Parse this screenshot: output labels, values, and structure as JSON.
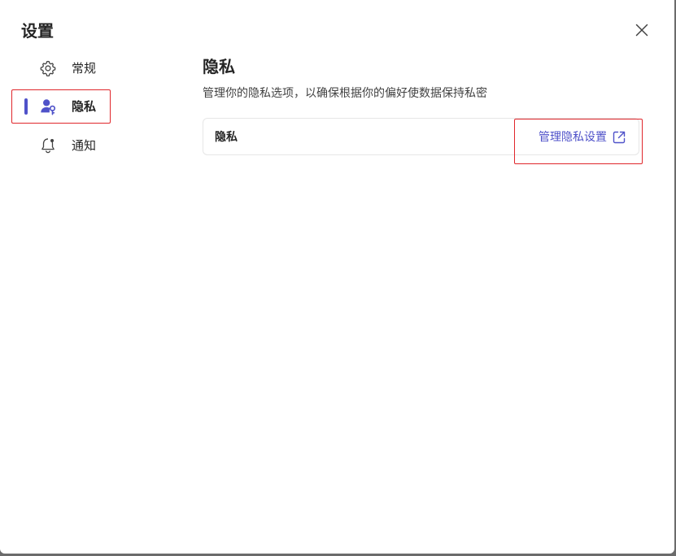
{
  "dialog": {
    "title": "设置",
    "close_icon": "close-icon"
  },
  "sidebar": {
    "items": [
      {
        "label": "常规",
        "icon": "gear-icon",
        "active": false
      },
      {
        "label": "隐私",
        "icon": "user-key-icon",
        "active": true
      },
      {
        "label": "通知",
        "icon": "bell-icon",
        "active": false
      }
    ]
  },
  "main": {
    "title": "隐私",
    "description": "管理你的隐私选项，以确保根据你的偏好使数据保持私密",
    "card": {
      "label": "隐私",
      "link_label": "管理隐私设置",
      "link_icon": "external-link-icon"
    }
  },
  "colors": {
    "accent": "#4f52c9",
    "highlight": "#e0262b",
    "text": "#242424"
  }
}
